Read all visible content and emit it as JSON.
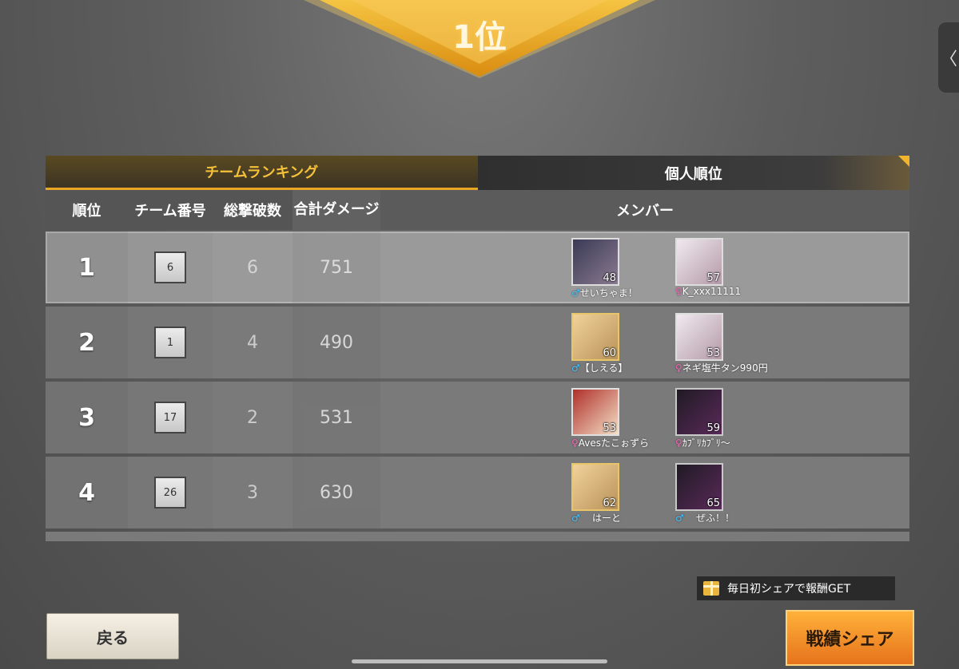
{
  "result_banner": "1位",
  "side_tab": {
    "icon": "chevron-left-icon",
    "glyph": "〈"
  },
  "tabs": [
    {
      "label": "チームランキング",
      "active": true
    },
    {
      "label": "個人順位",
      "active": false
    }
  ],
  "headers": {
    "rank": "順位",
    "team_no": "チーム番号",
    "kills": "総撃破数",
    "damage": "合計ダメージ",
    "members": "メンバー"
  },
  "rows": [
    {
      "rank": "1",
      "team": "6",
      "kills": "6",
      "damage": "751",
      "members": [
        {
          "gender": "♂",
          "name": "せいちゃま！",
          "level": "48"
        },
        {
          "gender": "♀",
          "name": "K_xxx11111",
          "level": "57"
        }
      ]
    },
    {
      "rank": "2",
      "team": "1",
      "kills": "4",
      "damage": "490",
      "members": [
        {
          "gender": "♂",
          "name": "【しえる】",
          "level": "60"
        },
        {
          "gender": "♀",
          "name": "ネギ塩牛タン990円",
          "level": "53"
        }
      ]
    },
    {
      "rank": "3",
      "team": "17",
      "kills": "2",
      "damage": "531",
      "members": [
        {
          "gender": "♀",
          "name": "Avesたこぉずら",
          "level": "53"
        },
        {
          "gender": "♀",
          "name": "ｶﾌﾞﾘｶﾌﾞﾘ〜",
          "level": "59"
        }
      ]
    },
    {
      "rank": "4",
      "team": "26",
      "kills": "3",
      "damage": "630",
      "members": [
        {
          "gender": "♂",
          "name": "はーと",
          "level": "62"
        },
        {
          "gender": "♂",
          "name": "ぜふ！！",
          "level": "65"
        }
      ]
    }
  ],
  "reward_note": "毎日初シェアで報酬GET",
  "buttons": {
    "back": "戻る",
    "share": "戦績シェア"
  },
  "colors": {
    "accent_gold": "#f6c13a",
    "male": "#44c4ff",
    "female": "#ff62b9",
    "share_orange": "#f39a2a"
  }
}
